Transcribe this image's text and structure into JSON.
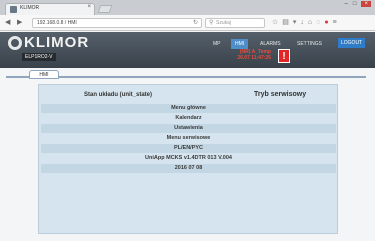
{
  "browser": {
    "tab_title": "KLIMOR",
    "url": "192.168.0.8 / HMI",
    "search_placeholder": "Szukaj"
  },
  "app": {
    "logo_text": "KLIMOR",
    "model_badge": "ELP1RO2-V",
    "nav": [
      "MP",
      "HMI",
      "ALARMS",
      "SETTINGS"
    ],
    "logout_label": "LOGOUT",
    "alarm_text_line1": "(NR) A_Temp",
    "alarm_text_line2": "26.07 11:47:26",
    "alarm_icon": "!"
  },
  "hmi": {
    "tab_label": "HMI",
    "state_label": "Stan układu (unit_state)",
    "state_value": "Tryb serwisowy",
    "menu_items": [
      "Menu główne",
      "Kalendarz",
      "Ustawienia",
      "Menu serwisowe",
      "PL/EN/PYC",
      "UniApp MCKS v1.4DTR 013 V.004",
      "2016 07 08"
    ]
  }
}
